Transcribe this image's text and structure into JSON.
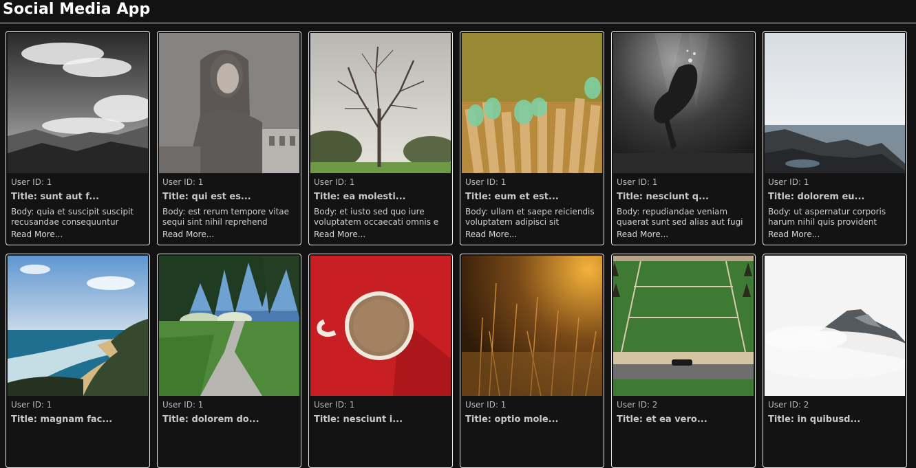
{
  "app": {
    "title": "Social Media App"
  },
  "posts": [
    {
      "user_label": "User ID: 1",
      "title": "Title: sunt aut f...",
      "body": "Body: quia et suscipit suscipit recusandae consequuntur",
      "read_more": "Read More...",
      "image_icon": "clouds-mountains-photo"
    },
    {
      "user_label": "User ID: 1",
      "title": "Title: qui est es...",
      "body": "Body: est rerum tempore vitae sequi sint nihil reprehend",
      "read_more": "Read More...",
      "image_icon": "woman-window-photo"
    },
    {
      "user_label": "User ID: 1",
      "title": "Title: ea molesti...",
      "body": "Body: et iusto sed quo iure voluptatem occaecati omnis e",
      "read_more": "Read More...",
      "image_icon": "bare-tree-photo"
    },
    {
      "user_label": "User ID: 1",
      "title": "Title: eum et est...",
      "body": "Body: ullam et saepe reiciendis voluptatem adipisci sit",
      "read_more": "Read More...",
      "image_icon": "fence-bottles-photo"
    },
    {
      "user_label": "User ID: 1",
      "title": "Title: nesciunt q...",
      "body": "Body: repudiandae veniam quaerat sunt sed alias aut fugi",
      "read_more": "Read More...",
      "image_icon": "underwater-diver-photo"
    },
    {
      "user_label": "User ID: 1",
      "title": "Title: dolorem eu...",
      "body": "Body: ut aspernatur corporis harum nihil quis provident",
      "read_more": "Read More...",
      "image_icon": "rocky-coast-photo"
    },
    {
      "user_label": "User ID: 1",
      "title": "Title: magnam fac...",
      "body": "",
      "read_more": "",
      "image_icon": "beach-coast-photo"
    },
    {
      "user_label": "User ID: 1",
      "title": "Title: dolorem do...",
      "body": "",
      "read_more": "",
      "image_icon": "forest-path-photo"
    },
    {
      "user_label": "User ID: 1",
      "title": "Title: nesciunt i...",
      "body": "",
      "read_more": "",
      "image_icon": "coffee-cup-photo"
    },
    {
      "user_label": "User ID: 1",
      "title": "Title: optio mole...",
      "body": "",
      "read_more": "",
      "image_icon": "golden-grass-photo"
    },
    {
      "user_label": "User ID: 2",
      "title": "Title: et ea vero...",
      "body": "",
      "read_more": "",
      "image_icon": "lawn-car-photo"
    },
    {
      "user_label": "User ID: 2",
      "title": "Title: in quibusd...",
      "body": "",
      "read_more": "",
      "image_icon": "misty-peak-photo"
    }
  ]
}
